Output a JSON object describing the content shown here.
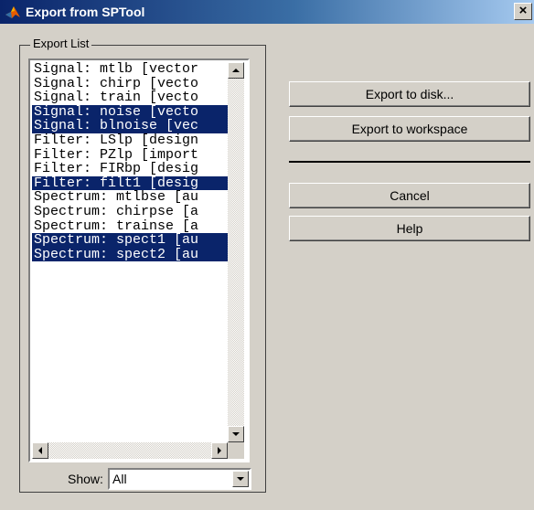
{
  "window": {
    "title": "Export from SPTool",
    "close_glyph": "×"
  },
  "export_list": {
    "label": "Export List",
    "items": [
      {
        "text": "Signal: mtlb [vector",
        "selected": false
      },
      {
        "text": "Signal: chirp [vecto",
        "selected": false
      },
      {
        "text": "Signal: train [vecto",
        "selected": false
      },
      {
        "text": "Signal: noise [vecto",
        "selected": true
      },
      {
        "text": "Signal: blnoise [vec",
        "selected": true
      },
      {
        "text": "Filter: LSlp [design",
        "selected": false
      },
      {
        "text": "Filter: PZlp [import",
        "selected": false
      },
      {
        "text": "Filter: FIRbp [desig",
        "selected": false
      },
      {
        "text": "Filter: filt1 [desig",
        "selected": true
      },
      {
        "text": "Spectrum: mtlbse [au",
        "selected": false
      },
      {
        "text": "Spectrum: chirpse [a",
        "selected": false
      },
      {
        "text": "Spectrum: trainse [a",
        "selected": false
      },
      {
        "text": "Spectrum: spect1 [au",
        "selected": true
      },
      {
        "text": "Spectrum: spect2 [au",
        "selected": true
      }
    ]
  },
  "show": {
    "label": "Show:",
    "value": "All"
  },
  "buttons": {
    "export_disk": "Export to disk...",
    "export_workspace": "Export to workspace",
    "cancel": "Cancel",
    "help": "Help"
  },
  "icons": {
    "app": "matlab-logo-icon",
    "close": "close-icon"
  },
  "colors": {
    "selection": "#0a246a",
    "face": "#d4d0c8"
  }
}
